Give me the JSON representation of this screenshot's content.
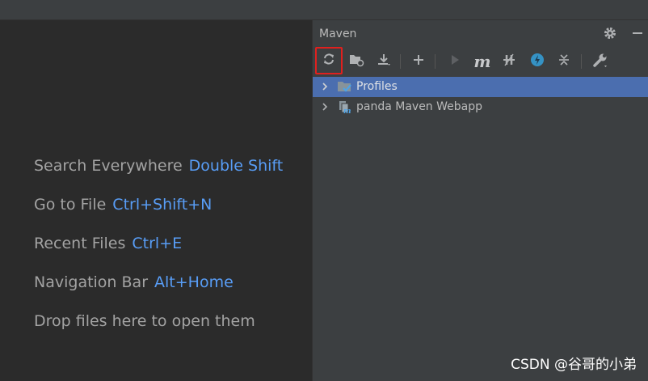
{
  "editor": {
    "hints": [
      {
        "label": "Search Everywhere",
        "key": "Double Shift"
      },
      {
        "label": "Go to File",
        "key": "Ctrl+Shift+N"
      },
      {
        "label": "Recent Files",
        "key": "Ctrl+E"
      },
      {
        "label": "Navigation Bar",
        "key": "Alt+Home"
      },
      {
        "label": "Drop files here to open them",
        "key": ""
      }
    ]
  },
  "maven_panel": {
    "title": "Maven",
    "header_icons": [
      "gear-icon",
      "minimize-icon"
    ],
    "toolbar": [
      {
        "name": "reload-all-maven-projects-button",
        "icon": "refresh-icon",
        "selected": true
      },
      {
        "name": "generate-sources-button",
        "icon": "folder-refresh-icon"
      },
      {
        "name": "download-sources-button",
        "icon": "download-icon"
      },
      {
        "name": "add-maven-project-button",
        "icon": "plus-icon"
      },
      {
        "name": "run-maven-build-button",
        "icon": "play-icon",
        "disabled": true
      },
      {
        "name": "execute-maven-goal-button",
        "icon": "maven-m-icon",
        "glyph": "m"
      },
      {
        "name": "toggle-offline-mode-button",
        "icon": "offline-icon"
      },
      {
        "name": "skip-tests-button",
        "icon": "skip-tests-icon"
      },
      {
        "name": "collapse-all-button",
        "icon": "collapse-icon"
      },
      {
        "name": "maven-settings-button",
        "icon": "wrench-icon"
      }
    ],
    "tree": [
      {
        "label": "Profiles",
        "icon": "profiles-folder-icon",
        "selected": true
      },
      {
        "label": "panda Maven Webapp",
        "icon": "maven-project-icon",
        "selected": false
      }
    ]
  },
  "watermark": "CSDN @谷哥的小弟",
  "colors": {
    "editor_bg": "#2b2b2b",
    "panel_bg": "#3c3f41",
    "shortcut_key": "#589df6",
    "selection": "#4b6eaf",
    "highlight_box": "#e0201e"
  }
}
